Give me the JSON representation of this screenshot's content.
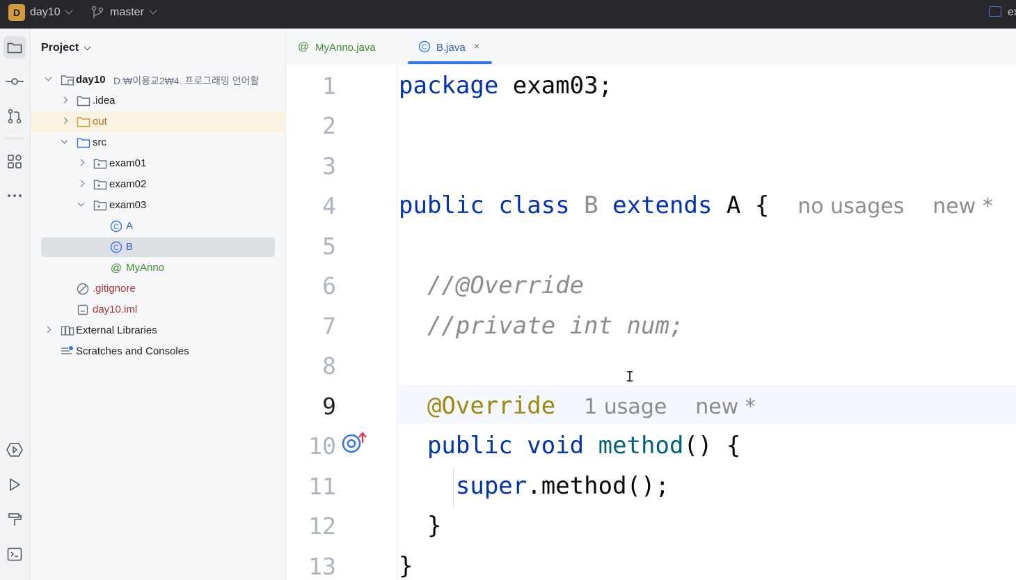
{
  "titlebar": {
    "project_badge": "D",
    "project_name": "day10",
    "branch": "master",
    "right_text": "ex"
  },
  "project_panel": {
    "title": "Project",
    "tree": [
      {
        "label": "day10",
        "path": "D:₩이용교2₩4. 프로그래밍 언어활",
        "kind": "module",
        "expanded": true
      },
      {
        "label": ".idea",
        "kind": "folder",
        "expanded": false
      },
      {
        "label": "out",
        "kind": "folder-excluded",
        "expanded": false
      },
      {
        "label": "src",
        "kind": "folder-source",
        "expanded": true
      },
      {
        "label": "exam01",
        "kind": "package",
        "expanded": false
      },
      {
        "label": "exam02",
        "kind": "package",
        "expanded": false
      },
      {
        "label": "exam03",
        "kind": "package",
        "expanded": true
      },
      {
        "label": "A",
        "kind": "class"
      },
      {
        "label": "B",
        "kind": "class",
        "selected": true
      },
      {
        "label": "MyAnno",
        "kind": "annotation"
      },
      {
        "label": ".gitignore",
        "kind": "ignore-file"
      },
      {
        "label": "day10.iml",
        "kind": "iml-file"
      },
      {
        "label": "External Libraries",
        "kind": "libraries",
        "expanded": false
      },
      {
        "label": "Scratches and Consoles",
        "kind": "scratches"
      }
    ]
  },
  "tabs": [
    {
      "label": "MyAnno.java",
      "icon": "annotation-icon",
      "active": false
    },
    {
      "label": "B.java",
      "icon": "class-icon",
      "active": true,
      "close": "×"
    }
  ],
  "editor": {
    "line_numbers": [
      "1",
      "2",
      "3",
      "4",
      "5",
      "6",
      "7",
      "8",
      "9",
      "10",
      "11",
      "12",
      "13"
    ],
    "current_line": "9",
    "lines": {
      "l1": {
        "kw": "package",
        "rest": " exam03;"
      },
      "l4": {
        "kw1": "public",
        "kw2": "class",
        "name": "B",
        "kw3": "extends",
        "rest": " A {",
        "hint1": "no usages",
        "hint2": "new *"
      },
      "l6": {
        "comment": "//@Override"
      },
      "l7": {
        "comment": "//private int num;"
      },
      "l9": {
        "annotation": "@Override",
        "hint1": "1 usage",
        "hint2": "new *"
      },
      "l10": {
        "kw1": "public",
        "kw2": "void",
        "fn": "method",
        "rest": "() {"
      },
      "l11": {
        "kw": "super",
        "rest": ".method();"
      },
      "l12": {
        "text": "}"
      },
      "l13": {
        "text": "}"
      }
    },
    "text_cursor": "I"
  },
  "colors": {
    "keyword": "#0033b3",
    "annotation": "#9e880d",
    "function": "#00627a",
    "comment": "#8c8c8c",
    "accent": "#3574f0"
  }
}
